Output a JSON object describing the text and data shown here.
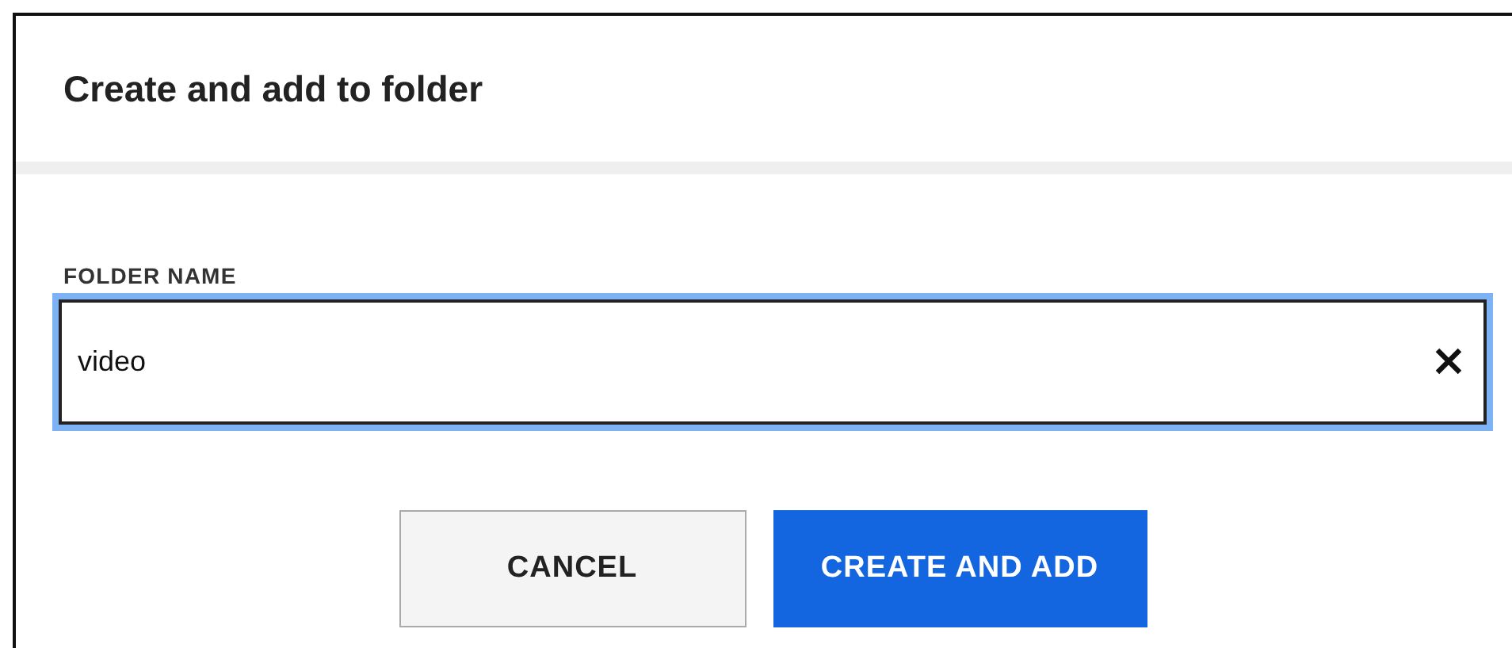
{
  "dialog": {
    "title": "Create and add to folder",
    "field": {
      "label": "FOLDER NAME",
      "value": "video",
      "focused": true
    },
    "buttons": [
      {
        "label": "CANCEL",
        "kind": "secondary"
      },
      {
        "label": "CREATE AND ADD",
        "kind": "primary"
      }
    ]
  }
}
